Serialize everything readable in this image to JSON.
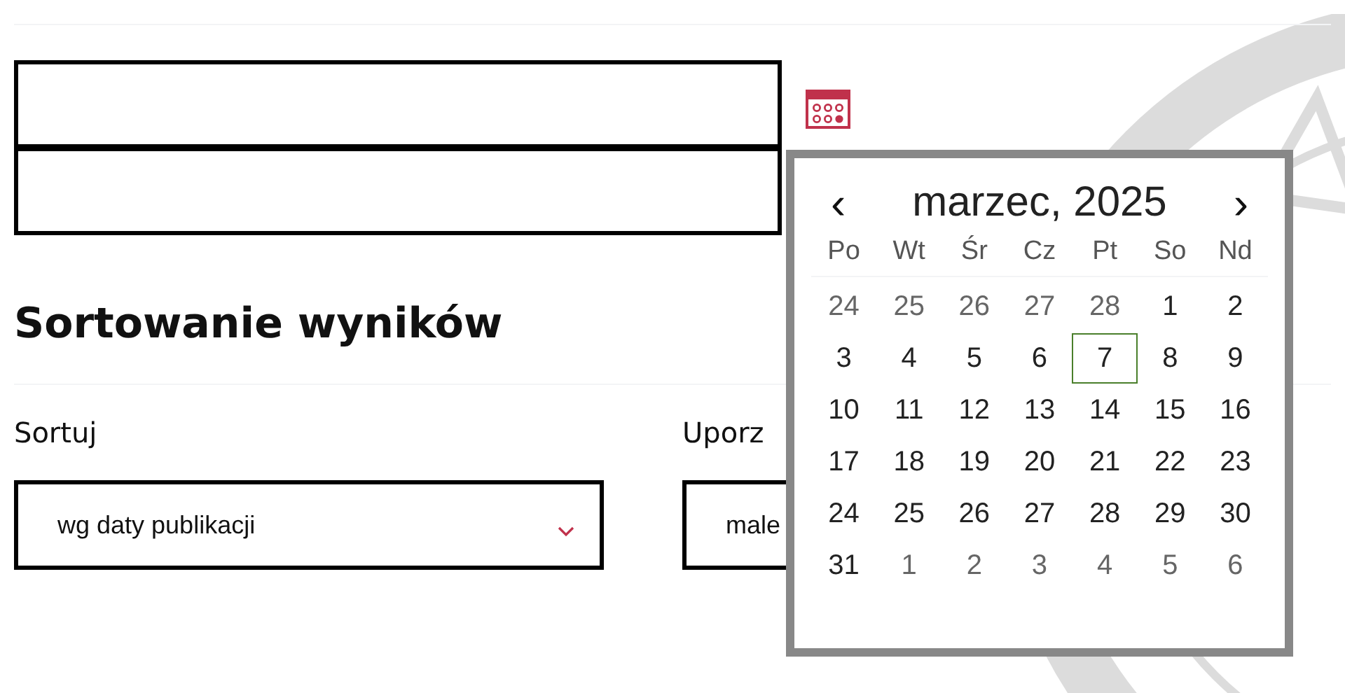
{
  "date_fields": [
    {
      "kind": "input"
    },
    {
      "kind": "input"
    }
  ],
  "datepicker": {
    "prev": "‹",
    "title": "marzec, 2025",
    "next": "›",
    "weekdays": [
      "Po",
      "Wt",
      "Śr",
      "Cz",
      "Pt",
      "So",
      "Nd"
    ],
    "weeks": [
      [
        {
          "day": "24",
          "other_month": true,
          "today": false
        },
        {
          "day": "25",
          "other_month": true,
          "today": false
        },
        {
          "day": "26",
          "other_month": true,
          "today": false
        },
        {
          "day": "27",
          "other_month": true,
          "today": false
        },
        {
          "day": "28",
          "other_month": true,
          "today": false
        },
        {
          "day": "1",
          "other_month": false,
          "today": false
        },
        {
          "day": "2",
          "other_month": false,
          "today": false
        }
      ],
      [
        {
          "day": "3",
          "other_month": false,
          "today": false
        },
        {
          "day": "4",
          "other_month": false,
          "today": false
        },
        {
          "day": "5",
          "other_month": false,
          "today": false
        },
        {
          "day": "6",
          "other_month": false,
          "today": false
        },
        {
          "day": "7",
          "other_month": false,
          "today": true
        },
        {
          "day": "8",
          "other_month": false,
          "today": false
        },
        {
          "day": "9",
          "other_month": false,
          "today": false
        }
      ],
      [
        {
          "day": "10",
          "other_month": false,
          "today": false
        },
        {
          "day": "11",
          "other_month": false,
          "today": false
        },
        {
          "day": "12",
          "other_month": false,
          "today": false
        },
        {
          "day": "13",
          "other_month": false,
          "today": false
        },
        {
          "day": "14",
          "other_month": false,
          "today": false
        },
        {
          "day": "15",
          "other_month": false,
          "today": false
        },
        {
          "day": "16",
          "other_month": false,
          "today": false
        }
      ],
      [
        {
          "day": "17",
          "other_month": false,
          "today": false
        },
        {
          "day": "18",
          "other_month": false,
          "today": false
        },
        {
          "day": "19",
          "other_month": false,
          "today": false
        },
        {
          "day": "20",
          "other_month": false,
          "today": false
        },
        {
          "day": "21",
          "other_month": false,
          "today": false
        },
        {
          "day": "22",
          "other_month": false,
          "today": false
        },
        {
          "day": "23",
          "other_month": false,
          "today": false
        }
      ],
      [
        {
          "day": "24",
          "other_month": false,
          "today": false
        },
        {
          "day": "25",
          "other_month": false,
          "today": false
        },
        {
          "day": "26",
          "other_month": false,
          "today": false
        },
        {
          "day": "27",
          "other_month": false,
          "today": false
        },
        {
          "day": "28",
          "other_month": false,
          "today": false
        },
        {
          "day": "29",
          "other_month": false,
          "today": false
        },
        {
          "day": "30",
          "other_month": false,
          "today": false
        }
      ],
      [
        {
          "day": "31",
          "other_month": false,
          "today": false
        },
        {
          "day": "1",
          "other_month": true,
          "today": false
        },
        {
          "day": "2",
          "other_month": true,
          "today": false
        },
        {
          "day": "3",
          "other_month": true,
          "today": false
        },
        {
          "day": "4",
          "other_month": true,
          "today": false
        },
        {
          "day": "5",
          "other_month": true,
          "today": false
        },
        {
          "day": "6",
          "other_month": true,
          "today": false
        }
      ]
    ]
  },
  "sorting": {
    "heading": "Sortowanie wyników",
    "fields": [
      {
        "label": "Sortuj",
        "value": "wg daty publikacji"
      },
      {
        "label": "Uporz",
        "value": "male"
      }
    ]
  }
}
